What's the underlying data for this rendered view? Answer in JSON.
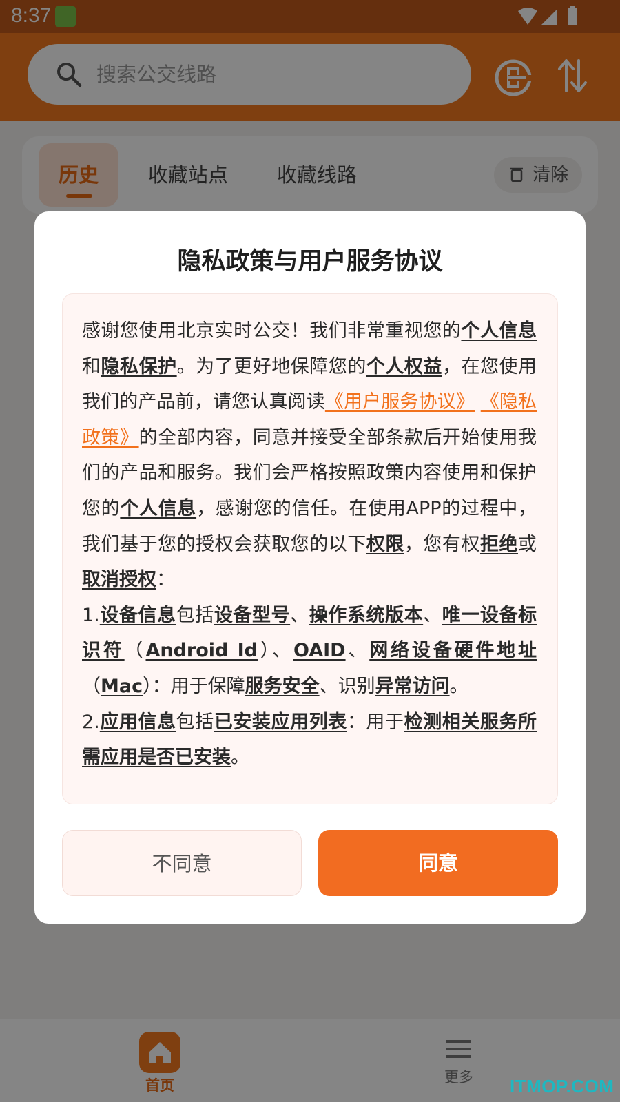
{
  "status_bar": {
    "time": "8:37"
  },
  "search": {
    "placeholder": "搜索公交线路"
  },
  "tabs": {
    "history": "历史",
    "fav_stops": "收藏站点",
    "fav_routes": "收藏线路",
    "clear": "清除"
  },
  "bottom_nav": {
    "home": "首页",
    "more": "更多"
  },
  "watermark": "ITMOP.COM",
  "dialog": {
    "title": "隐私政策与用户服务协议",
    "disagree": "不同意",
    "agree": "同意",
    "segments": [
      {
        "t": "感谢您使用北京实时公交！我们非常重视您的",
        "s": "n"
      },
      {
        "t": "个人信息",
        "s": "b"
      },
      {
        "t": "和",
        "s": "n"
      },
      {
        "t": "隐私保护",
        "s": "b"
      },
      {
        "t": "。为了更好地保障您的",
        "s": "n"
      },
      {
        "t": "个人权益",
        "s": "b"
      },
      {
        "t": "，在您使用我们的产品前，请您认真阅读",
        "s": "n"
      },
      {
        "t": "《用户服务协议》",
        "s": "a"
      },
      {
        "t": " ",
        "s": "n"
      },
      {
        "t": "《隐私政策》",
        "s": "a"
      },
      {
        "t": "的全部内容，同意并接受全部条款后开始使用我们的产品和服务。我们会严格按照政策内容使用和保护您的",
        "s": "n"
      },
      {
        "t": "个人信息",
        "s": "b"
      },
      {
        "t": "，感谢您的信任。在使用APP的过程中，我们基于您的授权会获取您的以下",
        "s": "n"
      },
      {
        "t": "权限",
        "s": "b"
      },
      {
        "t": "，您有权",
        "s": "n"
      },
      {
        "t": "拒绝",
        "s": "b"
      },
      {
        "t": "或",
        "s": "n"
      },
      {
        "t": "取消授权",
        "s": "b"
      },
      {
        "t": "：",
        "s": "n"
      },
      {
        "t": "",
        "s": "br"
      },
      {
        "t": "1.",
        "s": "n"
      },
      {
        "t": "设备信息",
        "s": "b"
      },
      {
        "t": "包括",
        "s": "n"
      },
      {
        "t": "设备型号",
        "s": "b"
      },
      {
        "t": "、",
        "s": "n"
      },
      {
        "t": "操作系统版本",
        "s": "b"
      },
      {
        "t": "、",
        "s": "n"
      },
      {
        "t": "唯一设备标识符",
        "s": "b"
      },
      {
        "t": "（",
        "s": "n"
      },
      {
        "t": "Android Id",
        "s": "b"
      },
      {
        "t": "）、",
        "s": "n"
      },
      {
        "t": "OAID",
        "s": "b"
      },
      {
        "t": "、",
        "s": "n"
      },
      {
        "t": "网络设备硬件地址",
        "s": "b"
      },
      {
        "t": "（",
        "s": "n"
      },
      {
        "t": "Mac",
        "s": "b"
      },
      {
        "t": "）：用于保障",
        "s": "n"
      },
      {
        "t": "服务安全",
        "s": "b"
      },
      {
        "t": "、识别",
        "s": "n"
      },
      {
        "t": "异常访问",
        "s": "b"
      },
      {
        "t": "。",
        "s": "n"
      },
      {
        "t": "",
        "s": "br"
      },
      {
        "t": "2.",
        "s": "n"
      },
      {
        "t": "应用信息",
        "s": "b"
      },
      {
        "t": "包括",
        "s": "n"
      },
      {
        "t": "已安装应用列表",
        "s": "b"
      },
      {
        "t": "：用于",
        "s": "n"
      },
      {
        "t": "检测相关服务所需应用是否已安装",
        "s": "b"
      },
      {
        "t": "。",
        "s": "n"
      }
    ]
  }
}
